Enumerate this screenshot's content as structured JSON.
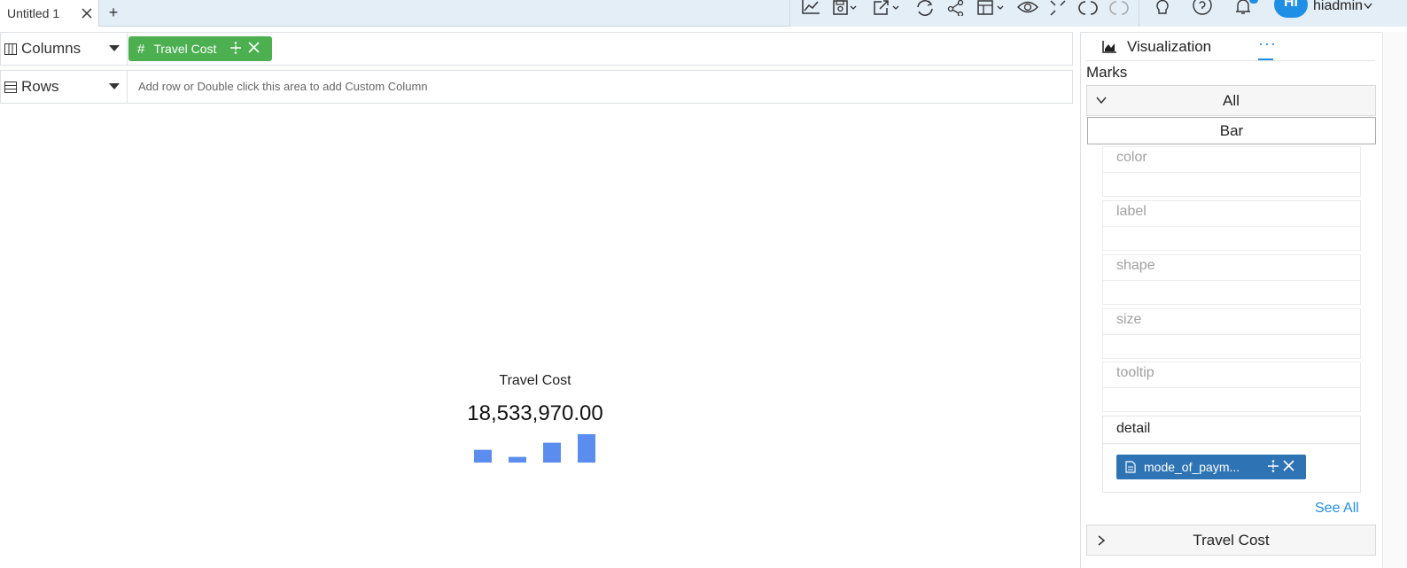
{
  "tabs": {
    "active_label": "Untitled 1"
  },
  "toolbar": {
    "icons": [
      "line-chart-icon",
      "save-icon",
      "export-icon",
      "refresh-icon",
      "share-icon",
      "layout-icon",
      "preview-icon",
      "fullscreen-icon",
      "undo-icon",
      "redo-icon",
      "lightbulb-icon",
      "help-icon",
      "bell-icon"
    ],
    "avatar_initials": "HI",
    "username": "hiadmin"
  },
  "shelves": {
    "columns": {
      "label": "Columns",
      "pill": "Travel Cost"
    },
    "rows": {
      "label": "Rows",
      "placeholder": "Add row or Double click this area to add Custom Column"
    }
  },
  "canvas": {
    "title": "Travel Cost",
    "value": "18,533,970.00"
  },
  "chart_data": {
    "type": "bar",
    "title": "Travel Cost",
    "categories": [
      "",
      "",
      "",
      ""
    ],
    "values": [
      4.5,
      2.0,
      7.0,
      10.0
    ],
    "ylim": [
      0,
      10
    ],
    "grid": false,
    "color": "#5b8def"
  },
  "panel": {
    "viz_tab": "Visualization",
    "more_tab": "···",
    "marks_label": "Marks",
    "all_label": "All",
    "mark_type": "Bar",
    "properties": [
      "color",
      "label",
      "shape",
      "size",
      "tooltip"
    ],
    "detail_label": "detail",
    "detail_pill": "mode_of_paym...",
    "see_all": "See All",
    "measure_label": "Travel Cost"
  },
  "colors": {
    "accent": "#1f8fe6",
    "pill_green": "#4caf50",
    "pill_blue": "#2e74b5",
    "bar": "#5b8def"
  }
}
